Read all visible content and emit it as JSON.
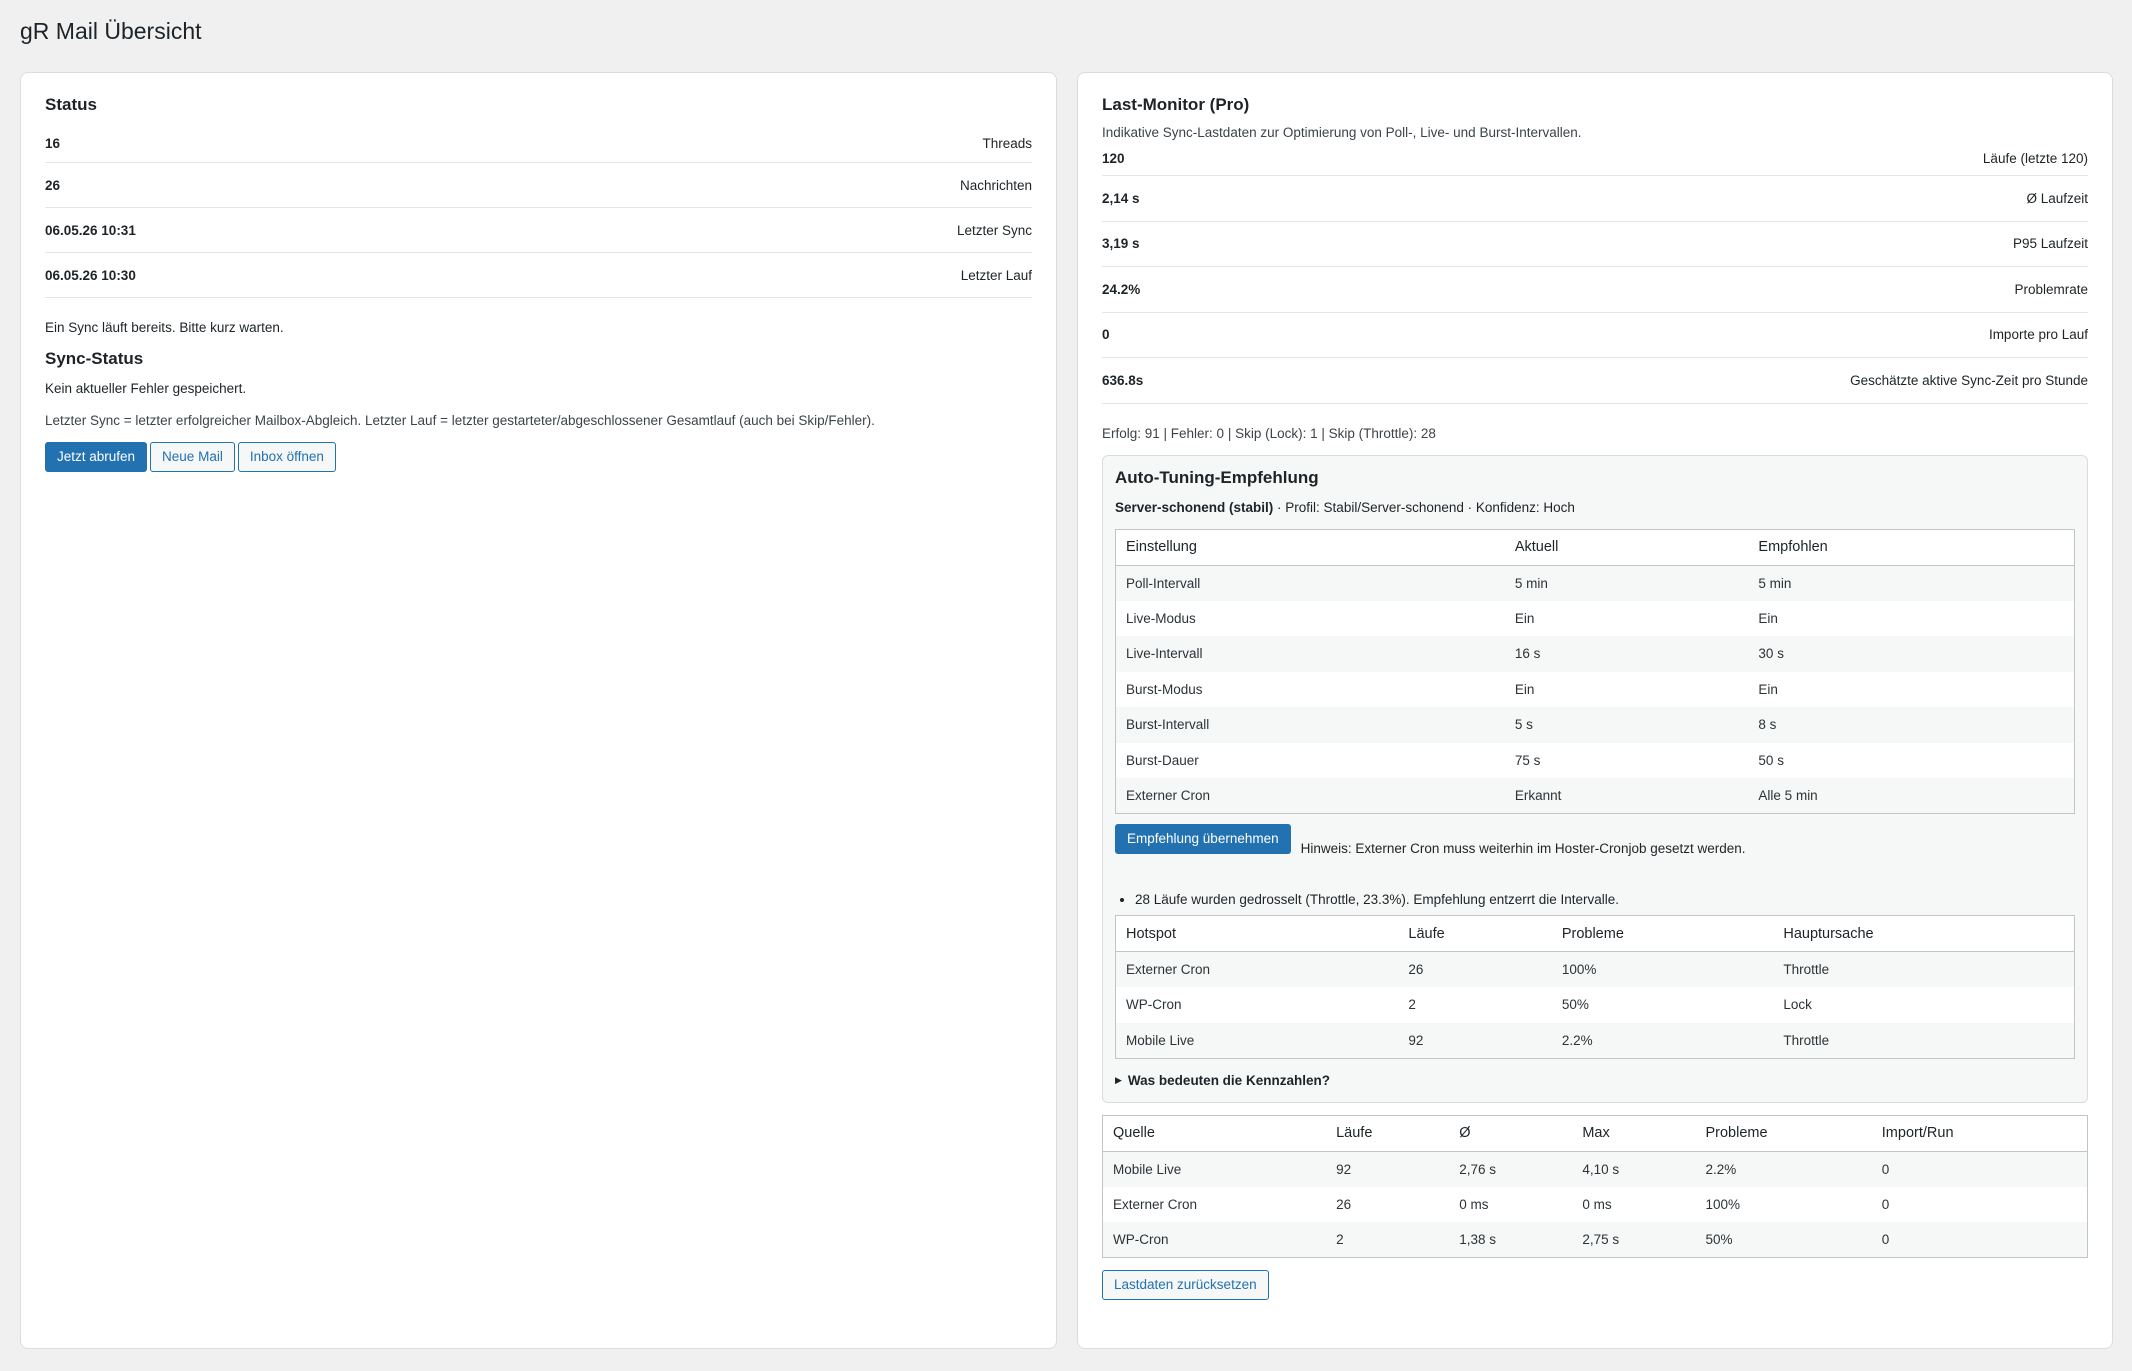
{
  "page_title": "gR Mail Übersicht",
  "status": {
    "title": "Status",
    "rows": [
      {
        "value": "16",
        "label": "Threads"
      },
      {
        "value": "26",
        "label": "Nachrichten"
      },
      {
        "value": "06.05.26 10:31",
        "label": "Letzter Sync"
      },
      {
        "value": "06.05.26 10:30",
        "label": "Letzter Lauf"
      }
    ],
    "notice": "Ein Sync läuft bereits. Bitte kurz warten.",
    "sync_title": "Sync-Status",
    "no_error": "Kein aktueller Fehler gespeichert.",
    "explain": "Letzter Sync = letzter erfolgreicher Mailbox-Abgleich. Letzter Lauf = letzter gestarteter/abgeschlossener Gesamtlauf (auch bei Skip/Fehler).",
    "buttons": {
      "fetch": "Jetzt abrufen",
      "new_mail": "Neue Mail",
      "inbox": "Inbox öffnen"
    }
  },
  "monitor": {
    "title": "Last-Monitor (Pro)",
    "description": "Indikative Sync-Lastdaten zur Optimierung von Poll-, Live- und Burst-Intervallen.",
    "rows": [
      {
        "value": "120",
        "label": "Läufe (letzte 120)"
      },
      {
        "value": "2,14 s",
        "label": "Ø Laufzeit"
      },
      {
        "value": "3,19 s",
        "label": "P95 Laufzeit"
      },
      {
        "value": "24.2%",
        "label": "Problemrate"
      },
      {
        "value": "0",
        "label": "Importe pro Lauf"
      },
      {
        "value": "636.8s",
        "label": "Geschätzte aktive Sync-Zeit pro Stunde"
      }
    ],
    "summary": "Erfolg: 91 | Fehler: 0 | Skip (Lock): 1 | Skip (Throttle): 28",
    "tuning": {
      "title": "Auto-Tuning-Empfehlung",
      "profile_bold": "Server-schonend (stabil)",
      "profile_rest": " · Profil: Stabil/Server-schonend · Konfidenz: Hoch",
      "headers": [
        "Einstellung",
        "Aktuell",
        "Empfohlen"
      ],
      "rows": [
        [
          "Poll-Intervall",
          "5 min",
          "5 min"
        ],
        [
          "Live-Modus",
          "Ein",
          "Ein"
        ],
        [
          "Live-Intervall",
          "16 s",
          "30 s"
        ],
        [
          "Burst-Modus",
          "Ein",
          "Ein"
        ],
        [
          "Burst-Intervall",
          "5 s",
          "8 s"
        ],
        [
          "Burst-Dauer",
          "75 s",
          "50 s"
        ],
        [
          "Externer Cron",
          "Erkannt",
          "Alle 5 min"
        ]
      ],
      "apply_button": "Empfehlung übernehmen",
      "hint": "Hinweis: Externer Cron muss weiterhin im Hoster-Cronjob gesetzt werden.",
      "bullet": "28 Läufe wurden gedrosselt (Throttle, 23.3%). Empfehlung entzerrt die Intervalle.",
      "hotspot_headers": [
        "Hotspot",
        "Läufe",
        "Probleme",
        "Hauptursache"
      ],
      "hotspot_rows": [
        [
          "Externer Cron",
          "26",
          "100%",
          "Throttle"
        ],
        [
          "WP-Cron",
          "2",
          "50%",
          "Lock"
        ],
        [
          "Mobile Live",
          "92",
          "2.2%",
          "Throttle"
        ]
      ],
      "details": "Was bedeuten die Kennzahlen?"
    },
    "source_headers": [
      "Quelle",
      "Läufe",
      "Ø",
      "Max",
      "Probleme",
      "Import/Run"
    ],
    "source_rows": [
      [
        "Mobile Live",
        "92",
        "2,76 s",
        "4,10 s",
        "2.2%",
        "0"
      ],
      [
        "Externer Cron",
        "26",
        "0 ms",
        "0 ms",
        "100%",
        "0"
      ],
      [
        "WP-Cron",
        "2",
        "1,38 s",
        "2,75 s",
        "50%",
        "0"
      ]
    ],
    "reset_button": "Lastdaten zurücksetzen"
  }
}
